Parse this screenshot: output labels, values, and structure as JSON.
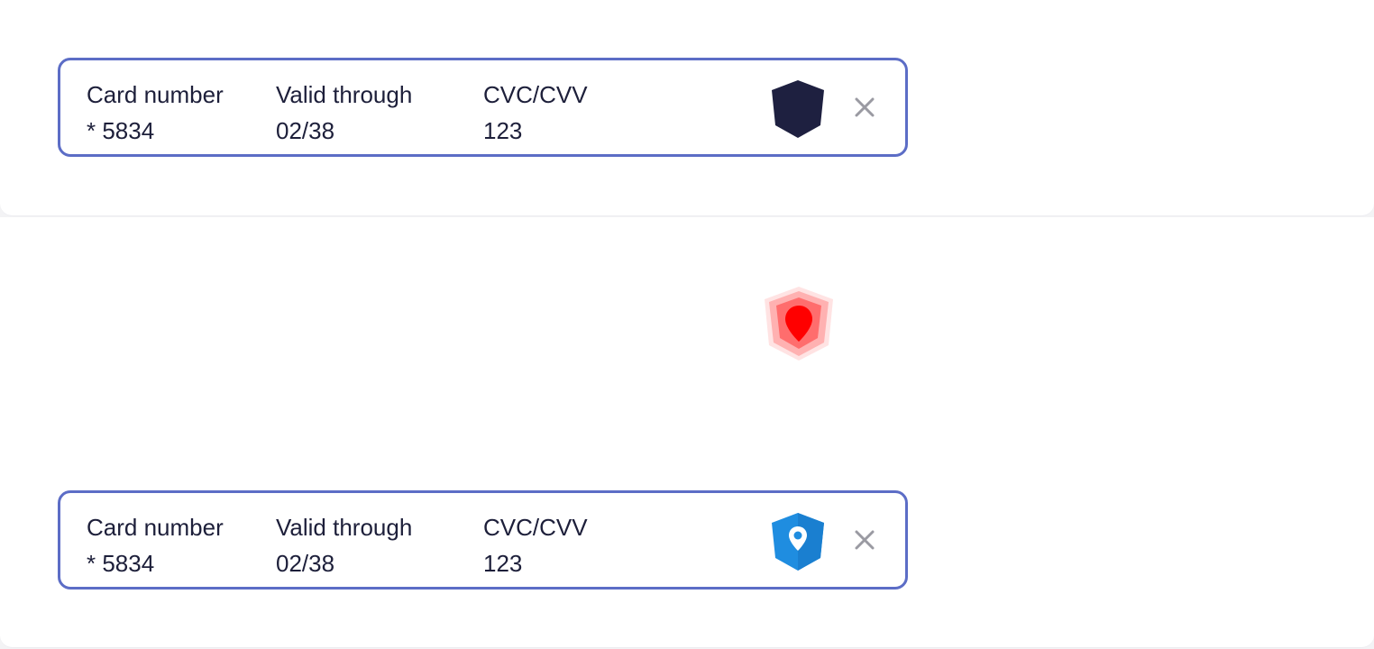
{
  "cards": [
    {
      "number_label": "Card number",
      "number_value": "* 5834",
      "valid_label": "Valid through",
      "valid_value": "02/38",
      "cvc_label": "CVC/CVV",
      "cvc_value": "123",
      "icon": "dark-shield-icon",
      "icon_color": "#1e2040"
    },
    {
      "number_label": "Card number",
      "number_value": "* 5834",
      "valid_label": "Valid through",
      "valid_value": "02/38",
      "cvc_label": "CVC/CVV",
      "cvc_value": "123",
      "icon": "location-shield-icon",
      "icon_color": "#1f8de0"
    }
  ],
  "floating_icon": "red-location-shield-icon",
  "colors": {
    "border": "#5c6dc6",
    "text": "#1d1f3a",
    "close": "#9a9aa2",
    "alert": "#ff1a1a"
  }
}
